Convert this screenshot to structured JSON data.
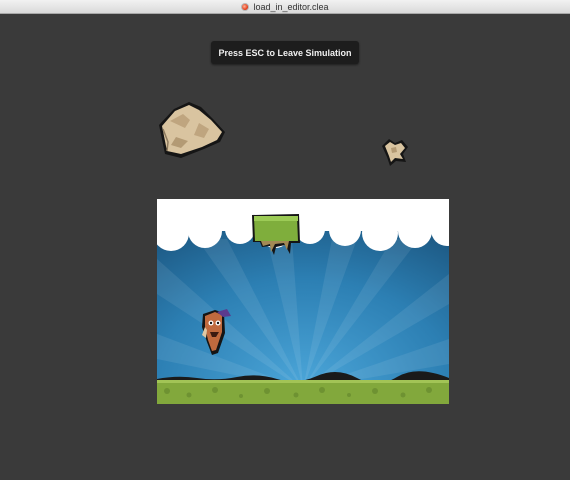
{
  "window": {
    "title": "load_in_editor.clea",
    "document_icon": "red-dot-icon"
  },
  "simulation": {
    "esc_message": "Press ESC to Leave Simulation"
  },
  "scene": {
    "background": {
      "sky_color": "#2d7fb1",
      "cloud_color": "#ffffff",
      "ground_color": "#7fa33a"
    },
    "sprites": [
      {
        "name": "large-rock",
        "icon": "rock-icon"
      },
      {
        "name": "small-rock",
        "icon": "rock-icon"
      },
      {
        "name": "grass-block",
        "icon": "grass-platform-icon"
      },
      {
        "name": "character",
        "icon": "creature-icon"
      }
    ]
  }
}
